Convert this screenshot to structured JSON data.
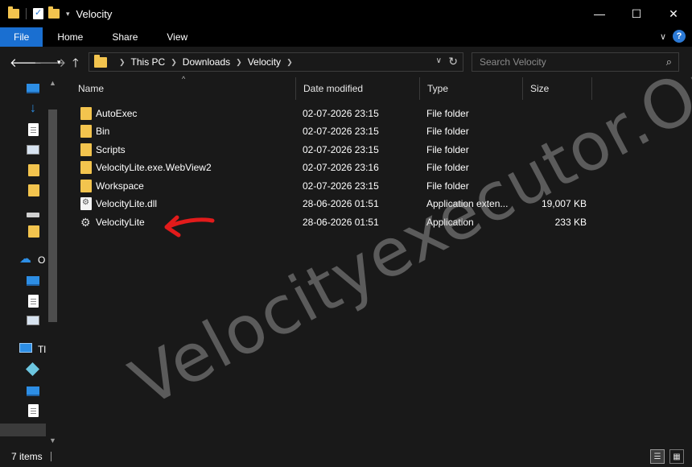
{
  "window": {
    "title": "Velocity",
    "minimize_glyph": "—",
    "maximize_glyph": "☐",
    "close_glyph": "✕"
  },
  "ribbon": {
    "tabs": [
      "File",
      "Home",
      "Share",
      "View"
    ],
    "help_glyph": "?",
    "expand_glyph": "∨"
  },
  "address": {
    "crumbs": [
      "This PC",
      "Downloads",
      "Velocity"
    ],
    "search_placeholder": "Search Velocity"
  },
  "nav_pane": {
    "onedrive_label": "O",
    "thispc_label": "Tl"
  },
  "columns": {
    "name": "Name",
    "date": "Date modified",
    "type": "Type",
    "size": "Size"
  },
  "files": [
    {
      "name": "AutoExec",
      "date": "02-07-2026 23:15",
      "type": "File folder",
      "size": "",
      "icon": "folder-icon"
    },
    {
      "name": "Bin",
      "date": "02-07-2026 23:15",
      "type": "File folder",
      "size": "",
      "icon": "folder-icon"
    },
    {
      "name": "Scripts",
      "date": "02-07-2026 23:15",
      "type": "File folder",
      "size": "",
      "icon": "folder-icon"
    },
    {
      "name": "VelocityLite.exe.WebView2",
      "date": "02-07-2026 23:16",
      "type": "File folder",
      "size": "",
      "icon": "folder-icon"
    },
    {
      "name": "Workspace",
      "date": "02-07-2026 23:15",
      "type": "File folder",
      "size": "",
      "icon": "folder-icon"
    },
    {
      "name": "VelocityLite.dll",
      "date": "28-06-2026 01:51",
      "type": "Application exten...",
      "size": "19,007 KB",
      "icon": "dll-icon"
    },
    {
      "name": "VelocityLite",
      "date": "28-06-2026 01:51",
      "type": "Application",
      "size": "233 KB",
      "icon": "app-icon"
    }
  ],
  "status": {
    "item_count": "7 items"
  },
  "watermark": "Velocityexecutor.Org",
  "colors": {
    "accent": "#1a6fd1",
    "folder": "#f3c44e",
    "annotation": "#e21b1b",
    "background": "#191919"
  }
}
